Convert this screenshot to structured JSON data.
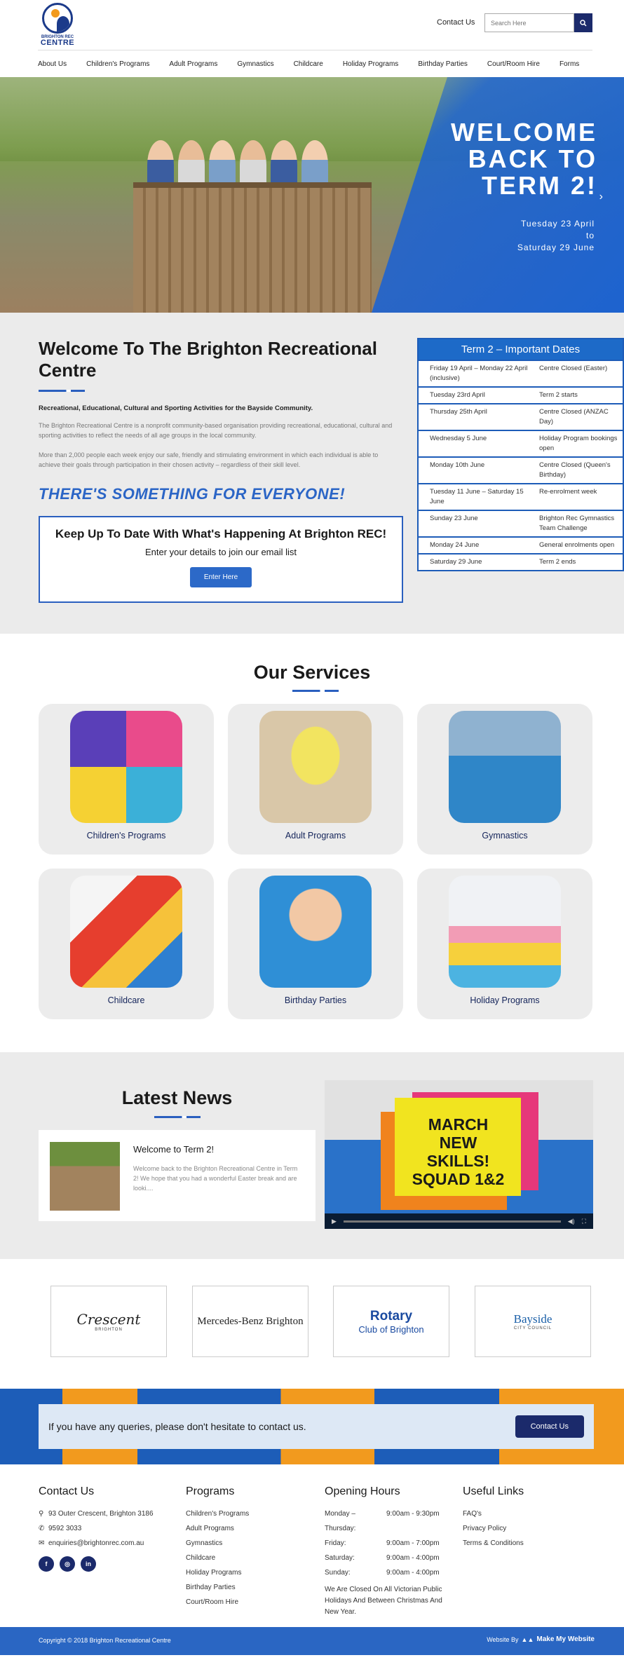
{
  "header": {
    "logo_top": "BRIGHTON REC",
    "logo_bottom": "CENTRE",
    "contact_link": "Contact Us",
    "search_placeholder": "Search Here",
    "nav": [
      "About Us",
      "Children's Programs",
      "Adult Programs",
      "Gymnastics",
      "Childcare",
      "Holiday Programs",
      "Birthday Parties",
      "Court/Room Hire",
      "Forms"
    ]
  },
  "hero": {
    "line1": "WELCOME",
    "line2": "BACK TO",
    "line3": "TERM 2!",
    "date1": "Tuesday 23 April",
    "date_to": "to",
    "date2": "Saturday 29 June"
  },
  "welcome": {
    "title": "Welcome To The Brighton Recreational Centre",
    "lead": "Recreational, Educational, Cultural and Sporting Activities for the Bayside Community.",
    "para1": "The Brighton Recreational Centre is a nonprofit community-based organisation providing recreational, educational, cultural and sporting activities to reflect the needs of all age groups in the local community.",
    "para2": "More than 2,000 people each week enjoy our safe, friendly and stimulating environment in which each individual is able to achieve their goals through participation in their chosen activity – regardless of their skill level.",
    "slogan": "THERE'S SOMETHING FOR EVERYONE!",
    "signup_title": "Keep Up To Date With What's Happening At Brighton REC!",
    "signup_sub": "Enter your details to join our email list",
    "signup_button": "Enter Here"
  },
  "dates": {
    "title": "Term 2 – Important Dates",
    "rows": [
      {
        "date": "Friday 19 April – Monday 22 April (inclusive)",
        "event": "Centre Closed (Easter)"
      },
      {
        "date": "Tuesday 23rd April",
        "event": "Term 2 starts"
      },
      {
        "date": "Thursday 25th April",
        "event": "Centre Closed (ANZAC Day)"
      },
      {
        "date": "Wednesday 5 June",
        "event": "Holiday Program bookings open"
      },
      {
        "date": "Monday 10th June",
        "event": "Centre Closed (Queen's Birthday)"
      },
      {
        "date": "Tuesday 11 June – Saturday 15 June",
        "event": "Re-enrolment week"
      },
      {
        "date": "Sunday 23 June",
        "event": "Brighton Rec Gymnastics Team Challenge"
      },
      {
        "date": "Monday 24 June",
        "event": "General enrolments open"
      },
      {
        "date": "Saturday 29 June",
        "event": "Term 2 ends"
      }
    ]
  },
  "services": {
    "title": "Our Services",
    "items": [
      "Children's Programs",
      "Adult Programs",
      "Gymnastics",
      "Childcare",
      "Birthday Parties",
      "Holiday Programs"
    ]
  },
  "news": {
    "title": "Latest News",
    "post_title": "Welcome to Term 2!",
    "post_excerpt": "Welcome back to the Brighton Recreational Centre in Term 2! We hope that you had a wonderful Easter break and are looki....",
    "video_text": "MARCH NEW SKILLS! SQUAD 1&2"
  },
  "sponsors": {
    "crescent": "Crescent",
    "crescent_small": "BRIGHTON",
    "mercedes": "Mercedes-Benz Brighton",
    "rotary": "Rotary",
    "rotary_sub": "Club of Brighton",
    "bayside": "Bayside",
    "bayside_small": "CITY COUNCIL"
  },
  "cta": {
    "text": "If you have any queries, please don't hesitate to contact us.",
    "button": "Contact Us"
  },
  "footer": {
    "contact_title": "Contact Us",
    "address": "93 Outer Crescent, Brighton 3186",
    "phone": "9592 3033",
    "email": "enquiries@brightonrec.com.au",
    "programs_title": "Programs",
    "programs": [
      "Children's Programs",
      "Adult Programs",
      "Gymnastics",
      "Childcare",
      "Holiday Programs",
      "Birthday Parties",
      "Court/Room Hire"
    ],
    "hours_title": "Opening Hours",
    "hours": [
      {
        "day": "Monday – Thursday:",
        "time": "9:00am - 9:30pm"
      },
      {
        "day": "Friday:",
        "time": "9:00am - 7:00pm"
      },
      {
        "day": "Saturday:",
        "time": "9:00am - 4:00pm"
      },
      {
        "day": "Sunday:",
        "time": "9:00am - 4:00pm"
      }
    ],
    "hours_note": "We Are Closed On All Victorian Public Holidays And Between Christmas And New Year.",
    "links_title": "Useful Links",
    "links": [
      "FAQ's",
      "Privacy Policy",
      "Terms & Conditions"
    ],
    "copyright": "Copyright © 2018 Brighton Recreational Centre",
    "credit_prefix": "Website By",
    "credit_name": "Make My Website"
  }
}
